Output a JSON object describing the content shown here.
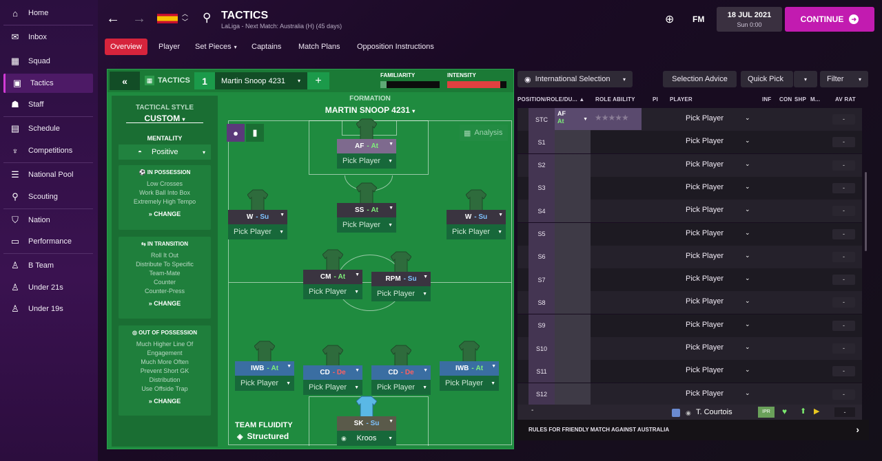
{
  "sidebar": {
    "items": [
      {
        "label": "Home",
        "icon": "home-icon"
      },
      {
        "label": "Inbox",
        "icon": "inbox-icon"
      },
      {
        "label": "Squad",
        "icon": "squad-icon"
      },
      {
        "label": "Tactics",
        "icon": "tactics-icon",
        "active": true
      },
      {
        "label": "Staff",
        "icon": "staff-icon"
      },
      {
        "label": "Schedule",
        "icon": "calendar-icon"
      },
      {
        "label": "Competitions",
        "icon": "trophy-icon"
      },
      {
        "label": "National Pool",
        "icon": "list-icon"
      },
      {
        "label": "Scouting",
        "icon": "search-icon"
      },
      {
        "label": "Nation",
        "icon": "shield-icon"
      },
      {
        "label": "Performance",
        "icon": "briefcase-icon"
      },
      {
        "label": "B Team",
        "icon": "team-b-icon"
      },
      {
        "label": "Under 21s",
        "icon": "team-u21-icon"
      },
      {
        "label": "Under 19s",
        "icon": "team-u19-icon"
      }
    ]
  },
  "header": {
    "title": "TACTICS",
    "subtitle": "LaLiga - Next Match: Australia (H) (45 days)",
    "fm": "FM",
    "date": "18 JUL 2021",
    "day": "Sun 0:00",
    "continue": "CONTINUE"
  },
  "tabs": [
    "Overview",
    "Player",
    "Set Pieces",
    "Captains",
    "Match Plans",
    "Opposition Instructions"
  ],
  "tactic": {
    "label": "TACTICS",
    "slot": "1",
    "name": "Martin Snoop 4231",
    "familiarity": "FAMILIARITY",
    "intensity": "INTENSITY",
    "formation_label": "FORMATION",
    "formation_name": "MARTIN SNOOP 4231",
    "analysis": "Analysis",
    "fluidity_label": "TEAM FLUIDITY",
    "fluidity": "Structured",
    "familiarity_level": 0.1,
    "intensity_level": 0.9
  },
  "style": {
    "label": "TACTICAL STYLE",
    "value": "CUSTOM",
    "mentality_label": "MENTALITY",
    "mentality": "Positive",
    "possession": {
      "title": "IN POSSESSION",
      "lines": [
        "Low Crosses",
        "Work Ball Into Box",
        "Extremely High Tempo"
      ],
      "change": "CHANGE"
    },
    "transition": {
      "title": "IN TRANSITION",
      "lines": [
        "Roll It Out",
        "Distribute To Specific",
        "Team-Mate",
        "Counter",
        "Counter-Press"
      ],
      "change": "CHANGE"
    },
    "outpossession": {
      "title": "OUT OF POSSESSION",
      "lines": [
        "Much Higher Line Of",
        "Engagement",
        "Much More Often",
        "Prevent Short GK",
        "Distribution",
        "Use Offside Trap"
      ],
      "change": "CHANGE"
    }
  },
  "players": [
    {
      "role": "AF",
      "duty": "At",
      "name": "Pick Player"
    },
    {
      "role": "W",
      "duty": "Su",
      "name": "Pick Player"
    },
    {
      "role": "SS",
      "duty": "At",
      "name": "Pick Player"
    },
    {
      "role": "W",
      "duty": "Su",
      "name": "Pick Player"
    },
    {
      "role": "CM",
      "duty": "At",
      "name": "Pick Player"
    },
    {
      "role": "RPM",
      "duty": "Su",
      "name": "Pick Player"
    },
    {
      "role": "IWB",
      "duty": "At",
      "name": "Pick Player"
    },
    {
      "role": "CD",
      "duty": "De",
      "name": "Pick Player"
    },
    {
      "role": "CD",
      "duty": "De",
      "name": "Pick Player"
    },
    {
      "role": "IWB",
      "duty": "At",
      "name": "Pick Player"
    },
    {
      "role": "SK",
      "duty": "Su",
      "name": "Kroos"
    }
  ],
  "right": {
    "selection": "International Selection",
    "advice": "Selection Advice",
    "quick": "Quick Pick",
    "filter": "Filter",
    "columns": [
      "POSITION/ROLE/DU...",
      "ROLE ABILITY",
      "PI",
      "PLAYER",
      "INF",
      "CON",
      "SHP",
      "M...",
      "AV RAT"
    ],
    "top_role": "AF",
    "top_duty": "At",
    "rows": [
      {
        "pos": "STC",
        "player": "Pick Player",
        "rat": "-"
      },
      {
        "pos": "S1",
        "player": "Pick Player",
        "rat": "-"
      },
      {
        "pos": "S2",
        "player": "Pick Player",
        "rat": "-"
      },
      {
        "pos": "S3",
        "player": "Pick Player",
        "rat": "-"
      },
      {
        "pos": "S4",
        "player": "Pick Player",
        "rat": "-"
      },
      {
        "pos": "S5",
        "player": "Pick Player",
        "rat": "-"
      },
      {
        "pos": "S6",
        "player": "Pick Player",
        "rat": "-"
      },
      {
        "pos": "S7",
        "player": "Pick Player",
        "rat": "-"
      },
      {
        "pos": "S8",
        "player": "Pick Player",
        "rat": "-"
      },
      {
        "pos": "S9",
        "player": "Pick Player",
        "rat": "-"
      },
      {
        "pos": "S10",
        "player": "Pick Player",
        "rat": "-"
      },
      {
        "pos": "S11",
        "player": "Pick Player",
        "rat": "-"
      },
      {
        "pos": "S12",
        "player": "Pick Player",
        "rat": "-"
      }
    ],
    "extra": {
      "pos": "-",
      "player": "T. Courtois",
      "badge": "IPR",
      "rat": "-"
    },
    "footer": "RULES FOR FRIENDLY MATCH AGAINST AUSTRALIA"
  },
  "colors": {
    "accent": "#c21bb0",
    "tab_active": "#d6243c",
    "pitch": "#1f8b3f"
  }
}
